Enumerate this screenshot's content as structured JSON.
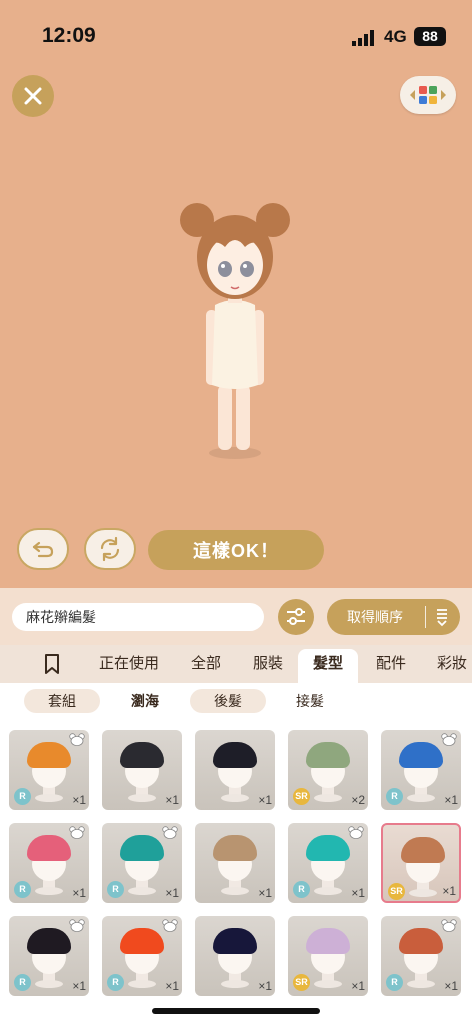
{
  "status_bar": {
    "time": "12:09",
    "network": "4G",
    "battery": "88"
  },
  "actions": {
    "ok_label": "這樣OK！"
  },
  "search": {
    "value": "麻花辮編髮"
  },
  "sort": {
    "label": "取得順序"
  },
  "categories": [
    {
      "label": "正在使用"
    },
    {
      "label": "全部"
    },
    {
      "label": "服裝"
    },
    {
      "label": "髮型",
      "active": true
    },
    {
      "label": "配件"
    },
    {
      "label": "彩妝"
    }
  ],
  "subcategories": [
    {
      "label": "套組"
    },
    {
      "label": "瀏海",
      "active": true
    },
    {
      "label": "後髮"
    },
    {
      "label": "接髮"
    }
  ],
  "items": [
    {
      "rarity": "R",
      "count": "×1",
      "hair_color": "#E88A2C",
      "favorite": true
    },
    {
      "rarity": "",
      "count": "×1",
      "hair_color": "#2a2a30",
      "favorite": false
    },
    {
      "rarity": "",
      "count": "×1",
      "hair_color": "#1e1e28",
      "favorite": false
    },
    {
      "rarity": "SR",
      "count": "×2",
      "hair_color": "#8FA77E",
      "favorite": false
    },
    {
      "rarity": "R",
      "count": "×1",
      "hair_color": "#2F70C8",
      "favorite": true
    },
    {
      "rarity": "R",
      "count": "×1",
      "hair_color": "#E5607A",
      "favorite": true
    },
    {
      "rarity": "R",
      "count": "×1",
      "hair_color": "#1FA09A",
      "favorite": true
    },
    {
      "rarity": "",
      "count": "×1",
      "hair_color": "#B89470",
      "favorite": false
    },
    {
      "rarity": "R",
      "count": "×1",
      "hair_color": "#22B7B0",
      "favorite": true
    },
    {
      "rarity": "SR",
      "count": "×1",
      "hair_color": "#C07A52",
      "favorite": false,
      "selected": true
    },
    {
      "rarity": "R",
      "count": "×1",
      "hair_color": "#1f1a22",
      "favorite": true
    },
    {
      "rarity": "R",
      "count": "×1",
      "hair_color": "#F04A1E",
      "favorite": true
    },
    {
      "rarity": "",
      "count": "×1",
      "hair_color": "#17173A",
      "favorite": false
    },
    {
      "rarity": "SR",
      "count": "×1",
      "hair_color": "#CDB0D6",
      "favorite": false
    },
    {
      "rarity": "R",
      "count": "×1",
      "hair_color": "#C95E3C",
      "favorite": true
    }
  ]
}
